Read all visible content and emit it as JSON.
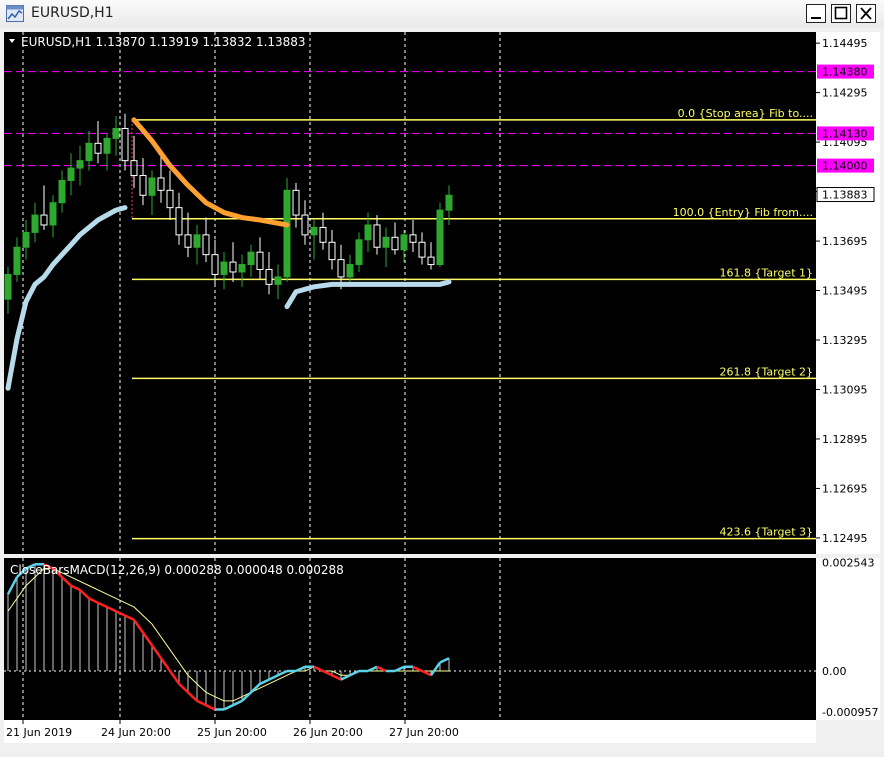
{
  "window": {
    "title": "EURUSD,H1",
    "icon": "chart-window-icon",
    "buttons": [
      "minimize-icon",
      "maximize-icon",
      "close-icon"
    ]
  },
  "colors": {
    "background": "#000000",
    "grid": "#ffffff",
    "axis_text": "#ffffff",
    "candle_up": "#2ea82e",
    "candle_down": "#ffffff",
    "fib": "#ffff66",
    "fib_text": "#ffff66",
    "magenta": "#ff00ff",
    "orange_line": "#ffa030",
    "lightblue_line": "#b7dbea",
    "macd_hist": "#c8c8c8",
    "macd_main_down": "#ff2020",
    "macd_main_up": "#5ad2e8",
    "macd_signal": "#ffff99"
  },
  "chart_data": [
    {
      "type": "candlestick",
      "header": "EURUSD,H1  1.13870 1.13919 1.13832 1.13883",
      "symbol": "EURUSD",
      "timeframe": "H1",
      "ohlc_last": {
        "open": 1.1387,
        "high": 1.13919,
        "low": 1.13832,
        "close": 1.13883
      },
      "ylim": [
        1.1243,
        1.1454
      ],
      "y_ticks": [
        {
          "label": "1.14495",
          "value": 1.14495
        },
        {
          "label": "1.14295",
          "value": 1.14295
        },
        {
          "label": "1.14095",
          "value": 1.14095
        },
        {
          "label": "1.13895",
          "value": 1.13895
        },
        {
          "label": "1.13695",
          "value": 1.13695
        },
        {
          "label": "1.13495",
          "value": 1.13495
        },
        {
          "label": "1.13295",
          "value": 1.13295
        },
        {
          "label": "1.13095",
          "value": 1.13095
        },
        {
          "label": "1.12895",
          "value": 1.12895
        },
        {
          "label": "1.12695",
          "value": 1.12695
        },
        {
          "label": "1.12495",
          "value": 1.12495
        }
      ],
      "price_levels": [
        {
          "label": "1.14380",
          "value": 1.1438,
          "color": "#ff00ff",
          "style": "dashed"
        },
        {
          "label": "1.14130",
          "value": 1.1413,
          "color": "#ff00ff",
          "style": "dashed"
        },
        {
          "label": "1.14000",
          "value": 1.14,
          "color": "#ff00ff",
          "style": "dashed"
        }
      ],
      "current_price": {
        "label": "1.13883",
        "value": 1.13883
      },
      "fibonacci": [
        {
          "label": "0.0  {Stop area} Fib to....",
          "value": 1.14185
        },
        {
          "label": "100.0 {Entry} Fib from....",
          "value": 1.13785
        },
        {
          "label": "161.8  {Target 1}",
          "value": 1.1354
        },
        {
          "label": "261.8   {Target  2}",
          "value": 1.1314
        },
        {
          "label": "423.6   {Target  3}",
          "value": 1.12492
        }
      ],
      "x_labels": [
        "21 Jun 2019",
        "24 Jun 20:00",
        "25 Jun 20:00",
        "26 Jun 20:00",
        "27 Jun 20:00"
      ],
      "candles": [
        [
          1.1346,
          1.1359,
          1.134,
          1.1356
        ],
        [
          1.1356,
          1.1371,
          1.1353,
          1.1367
        ],
        [
          1.1367,
          1.1378,
          1.1362,
          1.1373
        ],
        [
          1.1373,
          1.1385,
          1.1369,
          1.138
        ],
        [
          1.138,
          1.1392,
          1.1374,
          1.1376
        ],
        [
          1.1376,
          1.1388,
          1.1371,
          1.1385
        ],
        [
          1.1385,
          1.1398,
          1.1381,
          1.1394
        ],
        [
          1.1394,
          1.1405,
          1.1388,
          1.1399
        ],
        [
          1.1399,
          1.1408,
          1.1392,
          1.1402
        ],
        [
          1.1402,
          1.1414,
          1.1398,
          1.1409
        ],
        [
          1.1409,
          1.1418,
          1.1401,
          1.1405
        ],
        [
          1.1405,
          1.1413,
          1.1398,
          1.1411
        ],
        [
          1.1411,
          1.142,
          1.1404,
          1.1415
        ],
        [
          1.1415,
          1.1421,
          1.1398,
          1.1402
        ],
        [
          1.1402,
          1.1412,
          1.1391,
          1.1396
        ],
        [
          1.1396,
          1.1403,
          1.1384,
          1.1388
        ],
        [
          1.1388,
          1.1398,
          1.138,
          1.1395
        ],
        [
          1.1395,
          1.1405,
          1.1385,
          1.139
        ],
        [
          1.139,
          1.1398,
          1.1378,
          1.1383
        ],
        [
          1.1383,
          1.1389,
          1.1368,
          1.1372
        ],
        [
          1.1372,
          1.1381,
          1.1363,
          1.1367
        ],
        [
          1.1367,
          1.1376,
          1.136,
          1.1372
        ],
        [
          1.1372,
          1.1379,
          1.1361,
          1.1364
        ],
        [
          1.1364,
          1.137,
          1.1352,
          1.1356
        ],
        [
          1.1356,
          1.1365,
          1.135,
          1.1361
        ],
        [
          1.1361,
          1.1369,
          1.1353,
          1.1357
        ],
        [
          1.1357,
          1.1364,
          1.1351,
          1.136
        ],
        [
          1.136,
          1.1368,
          1.1355,
          1.1365
        ],
        [
          1.1365,
          1.1371,
          1.1354,
          1.1358
        ],
        [
          1.1358,
          1.1365,
          1.1348,
          1.1352
        ],
        [
          1.1352,
          1.136,
          1.1346,
          1.1355
        ],
        [
          1.1355,
          1.1395,
          1.1353,
          1.139
        ],
        [
          1.139,
          1.1393,
          1.1375,
          1.138
        ],
        [
          1.138,
          1.1386,
          1.1368,
          1.1372
        ],
        [
          1.1372,
          1.1378,
          1.1362,
          1.1375
        ],
        [
          1.1375,
          1.1381,
          1.1366,
          1.1369
        ],
        [
          1.1369,
          1.1374,
          1.1358,
          1.1362
        ],
        [
          1.1362,
          1.1368,
          1.135,
          1.1355
        ],
        [
          1.1355,
          1.1364,
          1.1352,
          1.136
        ],
        [
          1.136,
          1.1373,
          1.1357,
          1.137
        ],
        [
          1.137,
          1.1381,
          1.1365,
          1.1376
        ],
        [
          1.1376,
          1.138,
          1.1364,
          1.1367
        ],
        [
          1.1367,
          1.1375,
          1.1359,
          1.1371
        ],
        [
          1.1371,
          1.1377,
          1.1364,
          1.1366
        ],
        [
          1.1366,
          1.1374,
          1.1361,
          1.1372
        ],
        [
          1.1372,
          1.1378,
          1.1365,
          1.1369
        ],
        [
          1.1369,
          1.1373,
          1.136,
          1.1363
        ],
        [
          1.1363,
          1.1369,
          1.1358,
          1.136
        ],
        [
          1.136,
          1.1385,
          1.1359,
          1.1382
        ],
        [
          1.1382,
          1.1392,
          1.1376,
          1.1388
        ]
      ],
      "indicators": [
        {
          "name": "orange_ma",
          "points": [
            [
              14,
              1.14185
            ],
            [
              16,
              1.141
            ],
            [
              18,
              1.14
            ],
            [
              20,
              1.1392
            ],
            [
              22,
              1.1385
            ],
            [
              24,
              1.1381
            ],
            [
              26,
              1.1379
            ],
            [
              28,
              1.1378
            ],
            [
              31,
              1.1376
            ]
          ]
        },
        {
          "name": "lightblue_ma",
          "points": [
            [
              0,
              1.131
            ],
            [
              1,
              1.133
            ],
            [
              2,
              1.1345
            ],
            [
              3,
              1.1352
            ],
            [
              4,
              1.1355
            ],
            [
              5,
              1.136
            ],
            [
              6,
              1.1364
            ],
            [
              7,
              1.1368
            ],
            [
              8,
              1.1372
            ],
            [
              9,
              1.1375
            ],
            [
              10,
              1.1378
            ],
            [
              11,
              1.138
            ],
            [
              12,
              1.1382
            ],
            [
              13,
              1.1383
            ]
          ]
        },
        {
          "name": "lightblue_ma_2",
          "points": [
            [
              31,
              1.1343
            ],
            [
              32,
              1.1349
            ],
            [
              34,
              1.1351
            ],
            [
              36,
              1.1352
            ],
            [
              38,
              1.1352
            ],
            [
              40,
              1.1352
            ],
            [
              42,
              1.1352
            ],
            [
              44,
              1.1352
            ],
            [
              46,
              1.1352
            ],
            [
              48,
              1.1352
            ],
            [
              49,
              1.1353
            ]
          ]
        }
      ]
    },
    {
      "type": "macd",
      "header": "CloseBarsMACD(12,26,9) 0.000288 0.000048 0.000288",
      "ylim": [
        -0.0011,
        0.0026
      ],
      "y_ticks": [
        {
          "label": "0.002543",
          "value": 0.002543
        },
        {
          "label": "0.00",
          "value": 0.0
        },
        {
          "label": "-0.000957",
          "value": -0.000957
        }
      ],
      "histogram": [
        0.0018,
        0.0022,
        0.0024,
        0.0025,
        0.0025,
        0.0024,
        0.0022,
        0.002,
        0.0019,
        0.0017,
        0.0016,
        0.0015,
        0.0014,
        0.0013,
        0.0012,
        0.0009,
        0.0006,
        0.0003,
        0.0,
        -0.0003,
        -0.0005,
        -0.0007,
        -0.0008,
        -0.0009,
        -0.0009,
        -0.0008,
        -0.0007,
        -0.0005,
        -0.0003,
        -0.0002,
        -0.0001,
        0.0,
        0.0,
        0.0001,
        0.0001,
        0.0,
        -0.0001,
        -0.0002,
        -0.0001,
        0.0,
        0.0,
        0.0001,
        0.0,
        0.0,
        0.0001,
        0.0001,
        0.0,
        -0.0001,
        0.0002,
        0.0003
      ],
      "signal": [
        0.0014,
        0.0017,
        0.002,
        0.0022,
        0.0024,
        0.0024,
        0.0023,
        0.0022,
        0.0021,
        0.002,
        0.0019,
        0.0018,
        0.0017,
        0.0016,
        0.0015,
        0.0013,
        0.0011,
        0.0008,
        0.0005,
        0.0002,
        -0.0001,
        -0.0003,
        -0.0005,
        -0.0006,
        -0.0007,
        -0.0007,
        -0.0006,
        -0.0005,
        -0.0004,
        -0.0003,
        -0.0002,
        -0.0001,
        0.0,
        0.0,
        0.0001,
        0.0,
        0.0,
        -0.0001,
        -0.0001,
        0.0,
        0.0,
        0.0,
        0.0,
        0.0,
        0.0,
        0.0,
        0.0,
        0.0,
        0.0,
        0.0
      ]
    }
  ]
}
